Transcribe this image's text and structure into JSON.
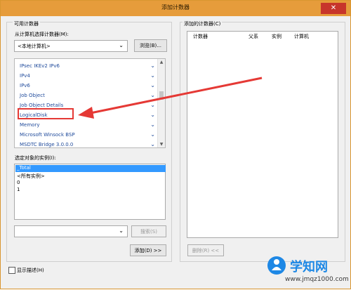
{
  "window": {
    "title": "添加计数器",
    "close_glyph": "✕"
  },
  "available": {
    "group_label": "可用计数器",
    "select_from_label": "从计算机选择计数器(M):",
    "computer_value": "<本地计算机>",
    "browse_label": "浏览(B)...",
    "objects": [
      "IPsec IKEv2 IPv6",
      "IPv4",
      "IPv6",
      "Job Object",
      "Job Object Details",
      "LogicalDisk",
      "Memory",
      "Microsoft Winsock BSP",
      "MSDTC Bridge 3.0.0.0"
    ],
    "highlighted_object": "LogicalDisk",
    "instances_label": "选定对象的实例(I):",
    "instances": [
      "_Total",
      "<所有实例>",
      "0",
      "1"
    ],
    "selected_instance": "_Total",
    "search_label": "搜索(S)",
    "add_label": "添加(D) >>"
  },
  "added": {
    "group_label": "添加的计数器(C)",
    "columns": [
      "计数器",
      "父系",
      "实例",
      "计算机"
    ],
    "remove_label": "删除(R) <<"
  },
  "footer": {
    "show_description_label": "显示描述(H)"
  },
  "watermark": {
    "text": "学知网",
    "url": "www.jmqz1000.com"
  },
  "colors": {
    "title_bar": "#e69c3b",
    "highlight": "#e53935",
    "selection": "#3399ff",
    "object_text": "#1f4a9b"
  },
  "icons": [
    "close-icon",
    "chevron-down-icon",
    "scroll-up-icon",
    "scroll-down-icon"
  ]
}
